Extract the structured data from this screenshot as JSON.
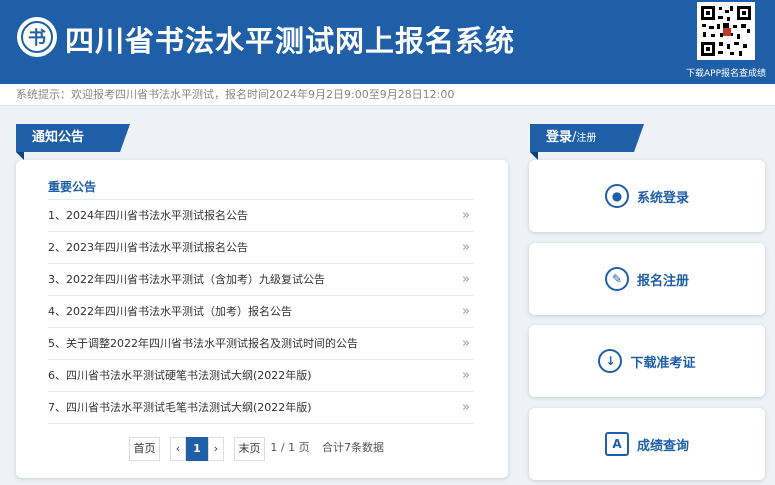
{
  "header": {
    "logo_char": "书",
    "title": "四川省书法水平测试网上报名系统",
    "qr_caption": "下载APP报名查成绩"
  },
  "notice": {
    "text": "系统提示：欢迎报考四川省书法水平测试，报名时间2024年9月2日9:00至9月28日12:00"
  },
  "left": {
    "tab_label": "通知公告",
    "section_title": "重要公告",
    "items": [
      {
        "label": "1、2024年四川省书法水平测试报名公告"
      },
      {
        "label": "2、2023年四川省书法水平测试报名公告"
      },
      {
        "label": "3、2022年四川省书法水平测试（含加考）九级复试公告"
      },
      {
        "label": "4、2022年四川省书法水平测试（加考）报名公告"
      },
      {
        "label": "5、关于调整2022年四川省书法水平测试报名及测试时间的公告"
      },
      {
        "label": "6、四川省书法水平测试硬笔书法测试大纲(2022年版)"
      },
      {
        "label": "7、四川省书法水平测试毛笔书法测试大纲(2022年版)"
      }
    ],
    "arrow": "»",
    "pager": {
      "first": "首页",
      "prev": "‹",
      "current": "1",
      "next": "›",
      "last": "末页",
      "page_info": "1 / 1 页",
      "total": "合计7条数据"
    }
  },
  "right": {
    "tab_label": "登录",
    "tab_sep": "/",
    "tab_label2": "注册",
    "buttons": [
      {
        "label": "系统登录",
        "icon": "user-icon",
        "glyph": "●"
      },
      {
        "label": "报名注册",
        "icon": "edit-icon",
        "glyph": "✎"
      },
      {
        "label": "下载准考证",
        "icon": "cloud-download-icon",
        "glyph": "↓"
      },
      {
        "label": "成绩查询",
        "icon": "score-icon",
        "glyph": "A"
      }
    ]
  },
  "colors": {
    "brand": "#1f5fa8",
    "background": "#eef1f5"
  }
}
